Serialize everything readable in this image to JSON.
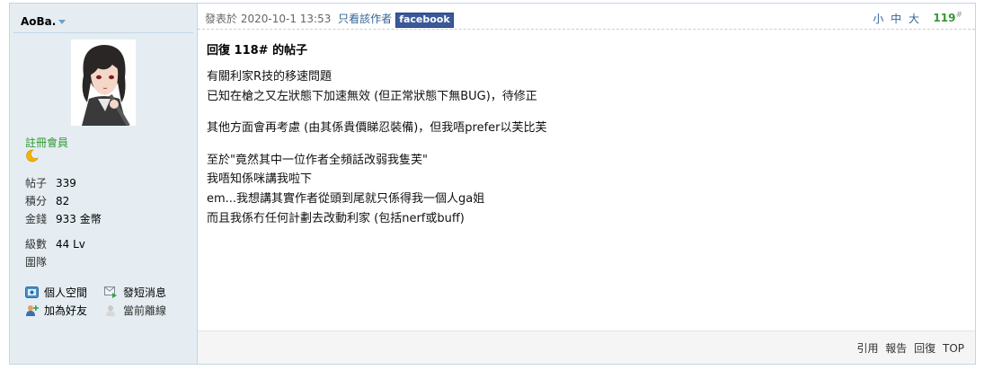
{
  "author": {
    "name": "AoBa.",
    "group": "註冊會員",
    "stats": [
      {
        "label": "帖子",
        "value": "339"
      },
      {
        "label": "積分",
        "value": "82"
      },
      {
        "label": "金錢",
        "value": "933 金幣"
      }
    ],
    "level": {
      "label": "級數",
      "value": "44 Lv"
    },
    "extra": "圍隊",
    "links": [
      "個人空間",
      "發短消息",
      "加為好友",
      "當前離線"
    ]
  },
  "post": {
    "posted_label": "發表於",
    "posted_time": "2020-10-1 13:53",
    "only_author": "只看該作者",
    "facebook": "facebook",
    "sizes": "小 中 大",
    "floor": "119",
    "floor_sup": "#",
    "title": "回復 118# 的帖子",
    "lines": [
      "有關利家R技的移速問題",
      "已知在槍之又左狀態下加速無效 (但正常狀態下無BUG)，待修正",
      "",
      "其他方面會再考慮 (由其係貴價睇忍裝備)，但我唔prefer以芙比芙",
      "",
      "至於\"竟然其中一位作者全頻話改弱我隻芙\"",
      "我唔知係咪講我啦下",
      "em...我想講其實作者從頭到尾就只係得我一個人ga姐",
      "而且我係冇任何計劃去改動利家 (包括nerf或buff)"
    ]
  },
  "actions": [
    "引用",
    "報告",
    "回復",
    "TOP"
  ],
  "colors": {
    "sidebar_bg": "#e5edf2",
    "border": "#c2d5e3",
    "group_green": "#339933",
    "link_blue": "#336699",
    "facebook_blue": "#3b5998"
  }
}
